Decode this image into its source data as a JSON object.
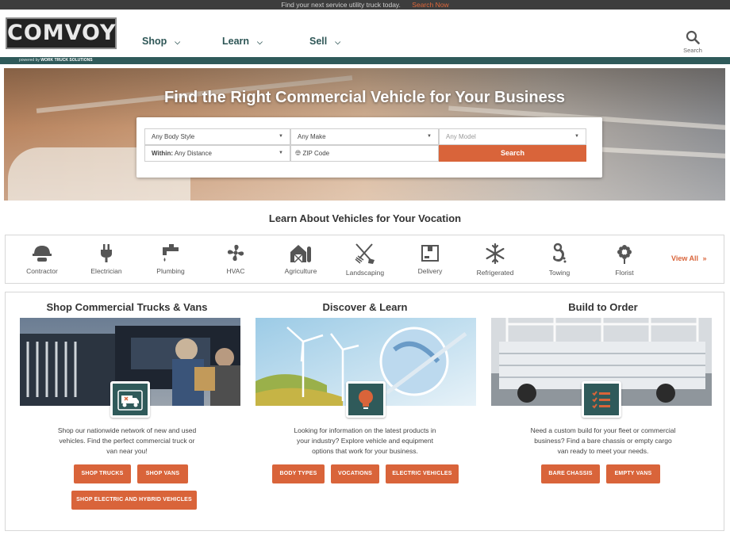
{
  "topbar": {
    "message": "Find your next service utility truck today.",
    "cta": "Search Now"
  },
  "header": {
    "logo": "COMVOY",
    "logo_sub_prefix": "powered by",
    "logo_sub_brand": "WORK TRUCK SOLUTIONS",
    "nav": [
      {
        "label": "Shop"
      },
      {
        "label": "Learn"
      },
      {
        "label": "Sell"
      }
    ],
    "search_label": "Search"
  },
  "hero": {
    "title": "Find the Right Commercial Vehicle for Your Business",
    "body_style": "Any Body Style",
    "make": "Any Make",
    "model": "Any Model",
    "within_label": "Within:",
    "distance": "Any Distance",
    "zip_placeholder": "ZIP Code",
    "search_button": "Search"
  },
  "vocations": {
    "title": "Learn About Vehicles for Your Vocation",
    "items": [
      {
        "label": "Contractor",
        "icon": "hard-hat-icon"
      },
      {
        "label": "Electrician",
        "icon": "plug-icon"
      },
      {
        "label": "Plumbing",
        "icon": "faucet-icon"
      },
      {
        "label": "HVAC",
        "icon": "fan-icon"
      },
      {
        "label": "Agriculture",
        "icon": "barn-icon"
      },
      {
        "label": "Landscaping",
        "icon": "shovel-rake-icon"
      },
      {
        "label": "Delivery",
        "icon": "box-icon"
      },
      {
        "label": "Refrigerated",
        "icon": "snowflake-icon"
      },
      {
        "label": "Towing",
        "icon": "tow-hook-icon"
      },
      {
        "label": "Florist",
        "icon": "flower-icon"
      }
    ],
    "view_all": "View All",
    "view_all_arrow": "»"
  },
  "columns": [
    {
      "title": "Shop Commercial Trucks & Vans",
      "badge_icon": "truck-icon",
      "desc_lines": [
        "Shop our nationwide network of new and used",
        "vehicles. Find the perfect commercial truck or",
        "van near you!"
      ],
      "buttons": [
        "SHOP TRUCKS",
        "SHOP VANS",
        "SHOP ELECTRIC AND HYBRID VEHICLES"
      ]
    },
    {
      "title": "Discover & Learn",
      "badge_icon": "lightbulb-icon",
      "desc_lines": [
        "Looking for information on the latest products in",
        "your industry? Explore vehicle and equipment",
        "options that work for your business."
      ],
      "buttons": [
        "BODY TYPES",
        "VOCATIONS",
        "ELECTRIC VEHICLES"
      ]
    },
    {
      "title": "Build to Order",
      "badge_icon": "checklist-icon",
      "desc_lines": [
        "Need a custom build for your fleet or commercial",
        "business? Find a bare chassis or empty cargo",
        "van ready to meet your needs."
      ],
      "buttons": [
        "BARE CHASSIS",
        "EMPTY VANS"
      ]
    }
  ],
  "colors": {
    "accent": "#d9643a",
    "brand": "#2f5a5a",
    "topbar": "#3d3d3d"
  }
}
